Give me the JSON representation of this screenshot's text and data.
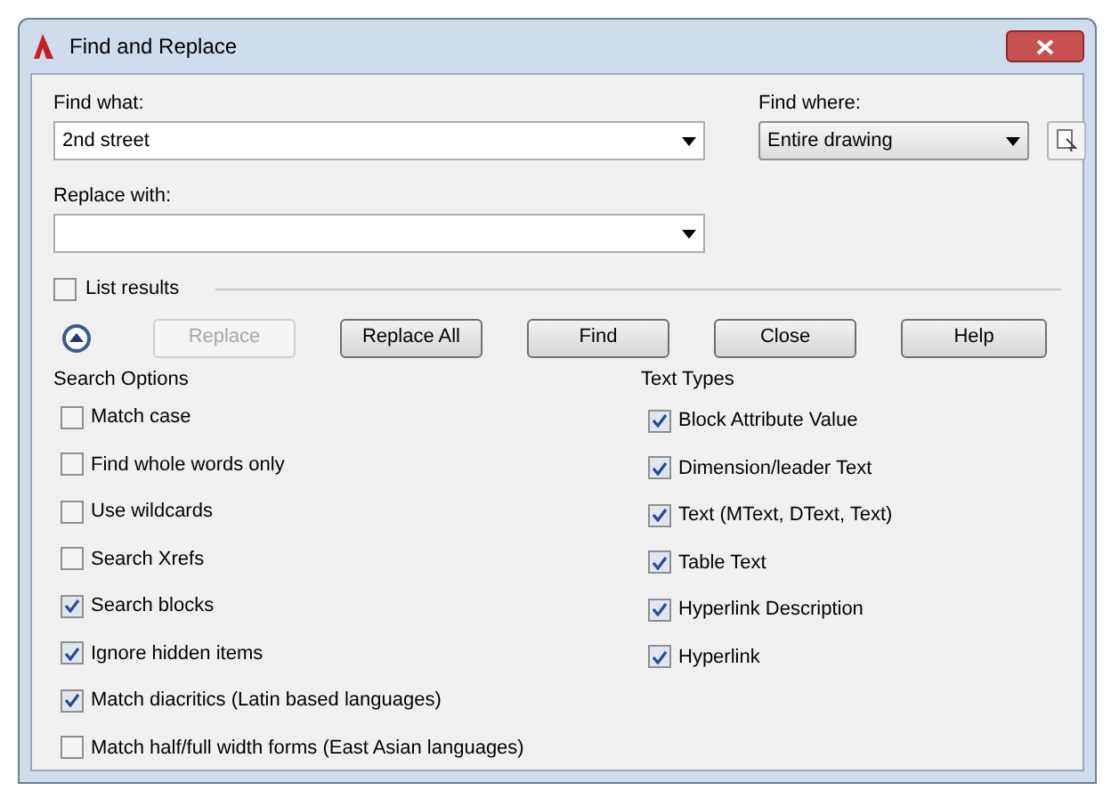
{
  "window": {
    "title": "Find and Replace"
  },
  "find_what": {
    "label": "Find what:",
    "value": "2nd street"
  },
  "find_where": {
    "label": "Find where:",
    "value": "Entire drawing"
  },
  "replace_with": {
    "label": "Replace with:"
  },
  "list_results": {
    "label": "List results",
    "checked": false
  },
  "buttons": [
    {
      "label": "Replace",
      "disabled": true
    },
    {
      "label": "Replace All",
      "disabled": false
    },
    {
      "label": "Find",
      "disabled": false
    },
    {
      "label": "Close",
      "disabled": false
    },
    {
      "label": "Help",
      "disabled": false
    }
  ],
  "search_options": {
    "title": "Search Options",
    "items": [
      {
        "label": "Match case",
        "checked": false
      },
      {
        "label": "Find whole words only",
        "checked": false
      },
      {
        "label": "Use wildcards",
        "checked": false
      },
      {
        "label": "Search Xrefs",
        "checked": false
      },
      {
        "label": "Search blocks",
        "checked": true
      },
      {
        "label": "Ignore hidden items",
        "checked": true
      },
      {
        "label": "Match diacritics (Latin based languages)",
        "checked": true
      },
      {
        "label": "Match half/full width forms (East Asian languages)",
        "checked": false
      }
    ]
  },
  "text_types": {
    "title": "Text Types",
    "items": [
      {
        "label": "Block Attribute Value",
        "checked": true
      },
      {
        "label": "Dimension/leader Text",
        "checked": true
      },
      {
        "label": "Text (MText, DText, Text)",
        "checked": true
      },
      {
        "label": "Table Text",
        "checked": true
      },
      {
        "label": "Hyperlink Description",
        "checked": true
      },
      {
        "label": "Hyperlink",
        "checked": true
      }
    ]
  }
}
